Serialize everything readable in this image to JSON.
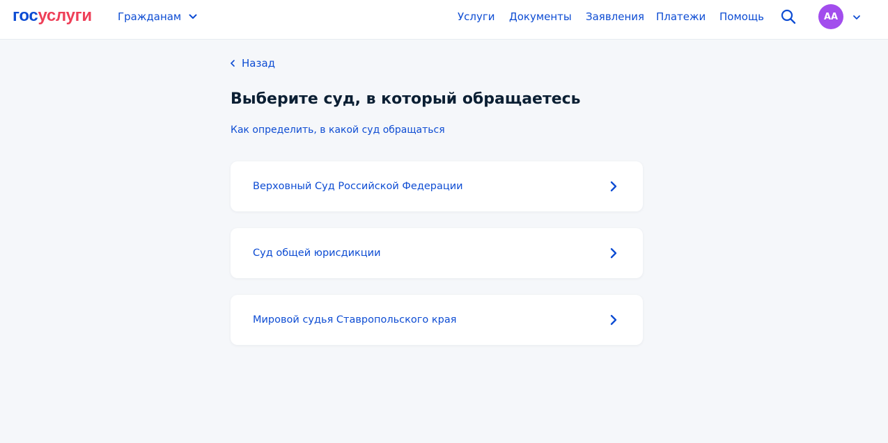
{
  "header": {
    "logo_part1": "гос",
    "logo_part2": "услуги",
    "audience_label": "Гражданам",
    "nav": [
      {
        "label": "Услуги"
      },
      {
        "label": "Документы"
      },
      {
        "label": "Заявления"
      },
      {
        "label": "Платежи"
      },
      {
        "label": "Помощь"
      }
    ],
    "search_icon": "search-icon",
    "avatar_initials": "АА",
    "avatar_color": "#a24ded"
  },
  "main": {
    "back_label": "Назад",
    "title": "Выберите суд, в который обращаетесь",
    "help_link": "Как определить, в какой суд обращаться",
    "options": [
      {
        "label": "Верховный Суд Российской Федерации"
      },
      {
        "label": "Суд общей юрисдикции"
      },
      {
        "label": "Мировой судья Ставропольского края"
      }
    ]
  },
  "colors": {
    "primary": "#0d4cd3",
    "accent": "#ee3f58",
    "background": "#f5f7fa",
    "text": "#0b1f33"
  }
}
